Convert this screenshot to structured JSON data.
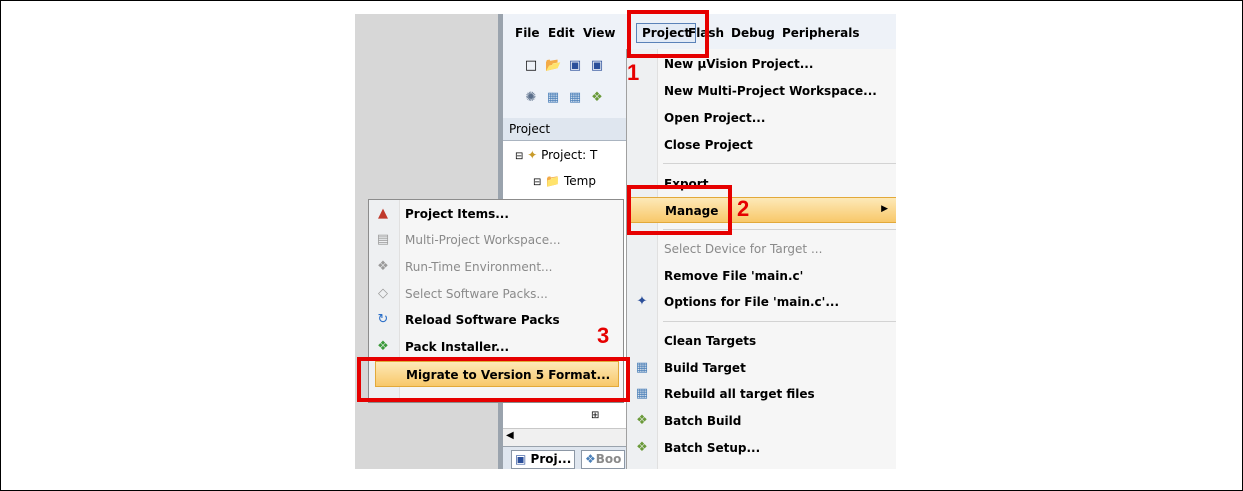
{
  "menubar": {
    "items": [
      "File",
      "Edit",
      "View",
      "Project",
      "Flash",
      "Debug",
      "Peripherals"
    ],
    "selected": "Project"
  },
  "project_panel": {
    "title": "Project",
    "tree": [
      "Project: T",
      "Temp"
    ],
    "tabs": [
      "Proj...",
      "Boo"
    ]
  },
  "project_menu": {
    "items": [
      {
        "label": "New µVision Project...",
        "enabled": true
      },
      {
        "label": "New Multi-Project Workspace...",
        "enabled": true
      },
      {
        "label": "Open Project...",
        "enabled": true
      },
      {
        "label": "Close Project",
        "enabled": true
      },
      {
        "label": "Export",
        "enabled": true
      },
      {
        "label": "Manage",
        "enabled": true,
        "highlighted": true
      },
      {
        "label": "Select Device for Target ...",
        "enabled": false
      },
      {
        "label": "Remove File 'main.c'",
        "enabled": true
      },
      {
        "label": "Options for File 'main.c'...",
        "enabled": true,
        "icon": "options-wand-icon"
      },
      {
        "label": "Clean Targets",
        "enabled": true
      },
      {
        "label": "Build Target",
        "enabled": true,
        "icon": "build-icon"
      },
      {
        "label": "Rebuild all target files",
        "enabled": true,
        "icon": "rebuild-icon"
      },
      {
        "label": "Batch Build",
        "enabled": true,
        "icon": "batch-build-icon"
      },
      {
        "label": "Batch Setup...",
        "enabled": true,
        "icon": "batch-setup-icon"
      }
    ]
  },
  "manage_submenu": {
    "items": [
      {
        "label": "Project Items...",
        "enabled": true,
        "icon": "project-items-icon"
      },
      {
        "label": "Multi-Project Workspace...",
        "enabled": false,
        "icon": "workspace-icon"
      },
      {
        "label": "Run-Time Environment...",
        "enabled": false,
        "icon": "rte-icon"
      },
      {
        "label": "Select Software Packs...",
        "enabled": false,
        "icon": "packs-icon"
      },
      {
        "label": "Reload Software Packs",
        "enabled": true,
        "icon": "reload-icon"
      },
      {
        "label": "Pack Installer...",
        "enabled": true,
        "icon": "pack-installer-icon"
      },
      {
        "label": "Migrate to Version 5 Format...",
        "enabled": true,
        "highlighted": true
      }
    ]
  },
  "callouts": [
    "1",
    "2",
    "3"
  ],
  "colors": {
    "callout": "#e60000",
    "highlight": "#f8c86a"
  }
}
